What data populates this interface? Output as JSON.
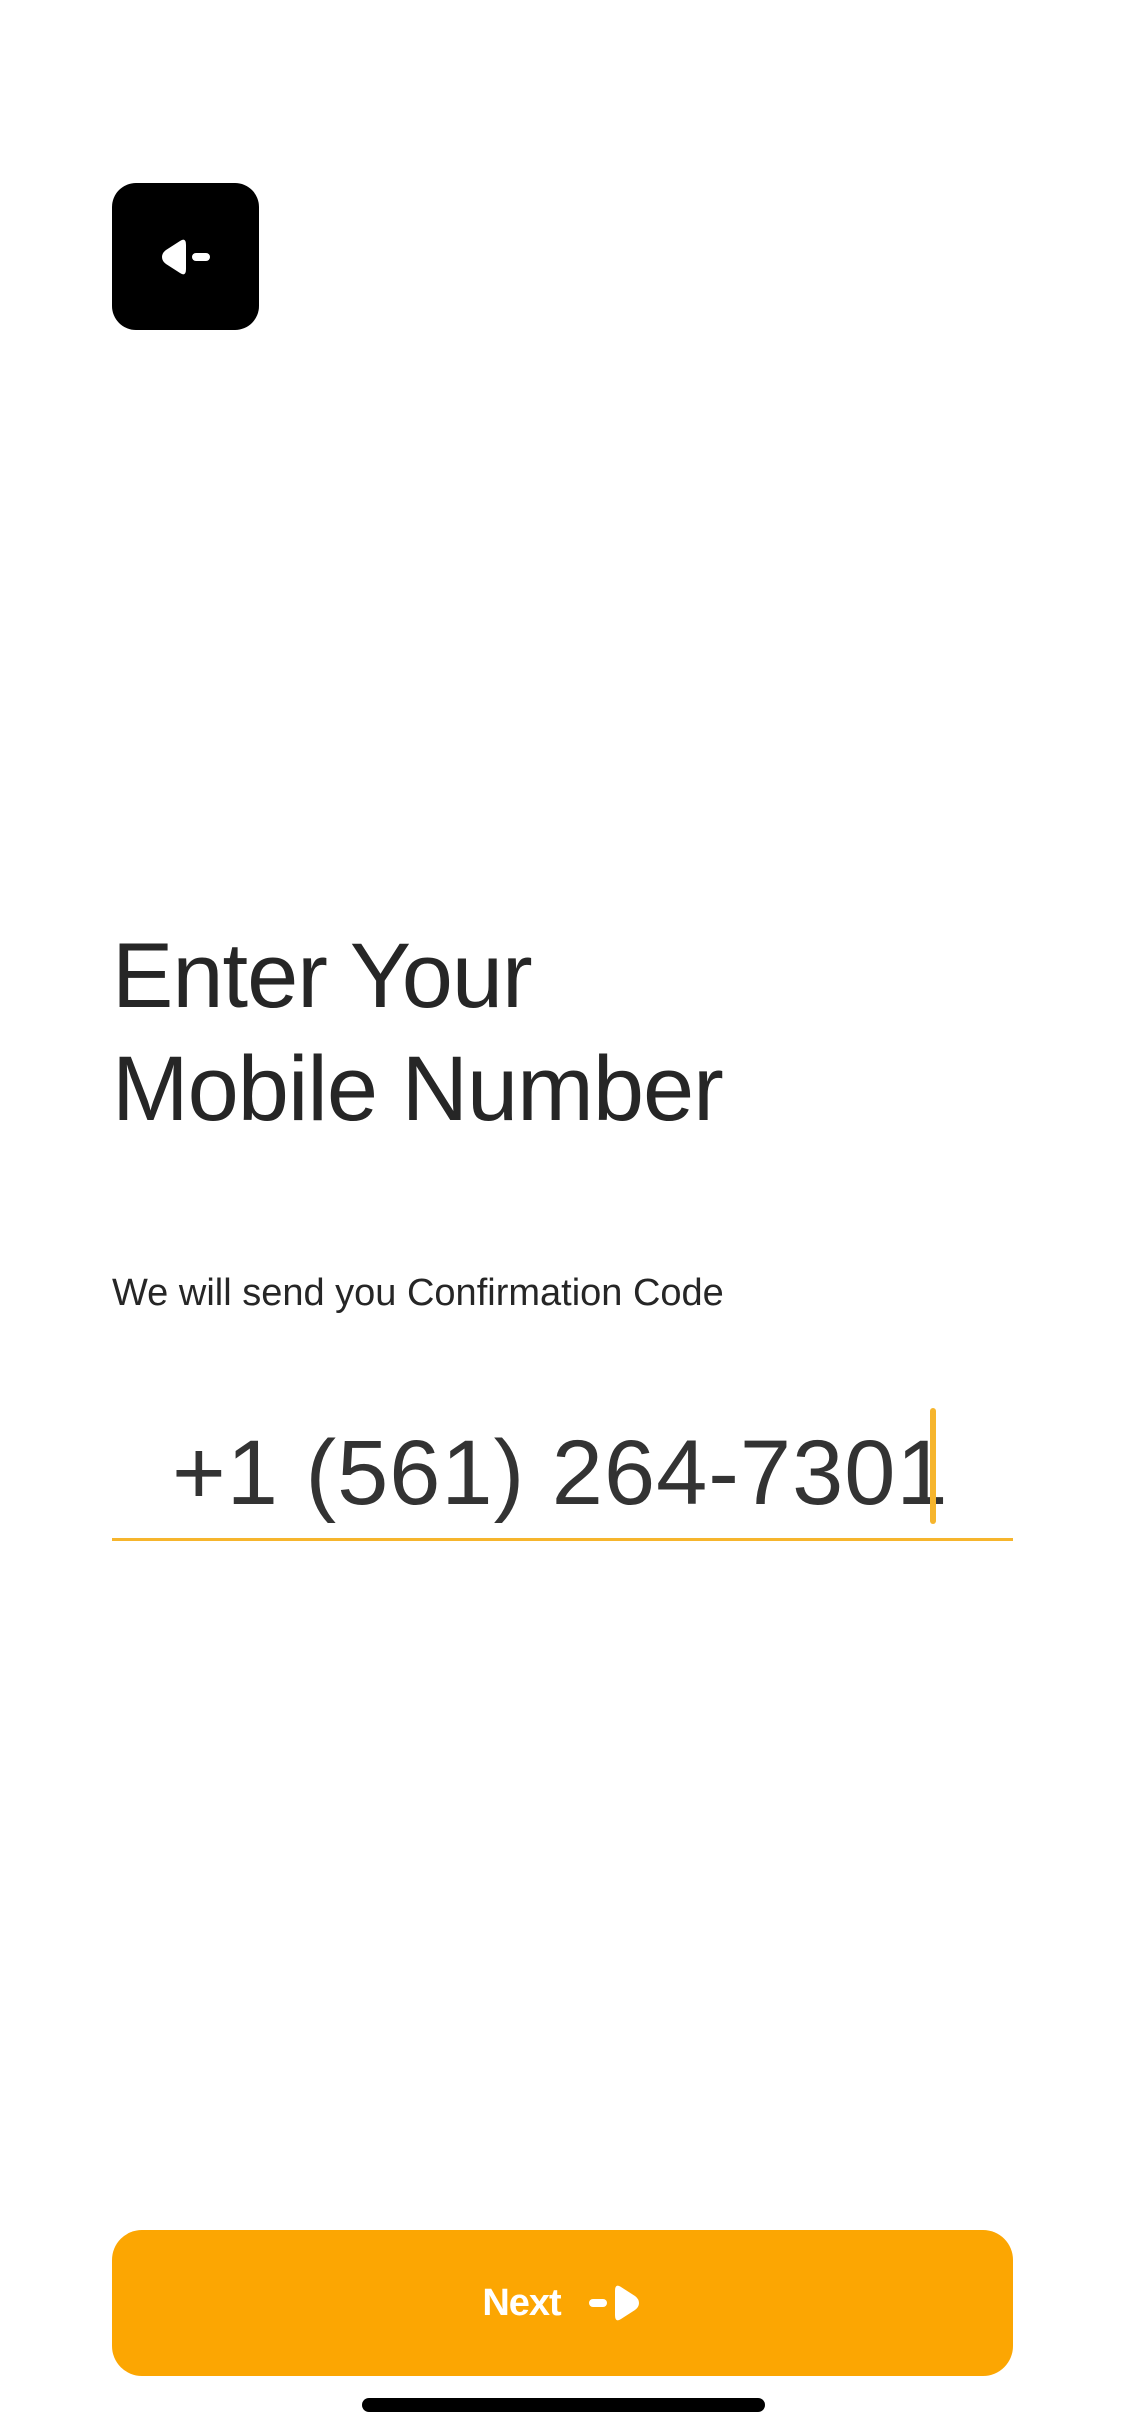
{
  "header": {
    "back_icon": "back-arrow-icon"
  },
  "main": {
    "title_line1": "Enter Your",
    "title_line2": "Mobile Number",
    "subtitle": "We will send you Confirmation Code",
    "phone": {
      "value": "+1 (561) 264-7301"
    }
  },
  "footer": {
    "next_label": "Next",
    "next_icon": "forward-arrow-icon"
  },
  "colors": {
    "accent": "#FCA602",
    "input_underline": "#F6B52D",
    "back_button_bg": "#000000",
    "text": "#262626"
  }
}
